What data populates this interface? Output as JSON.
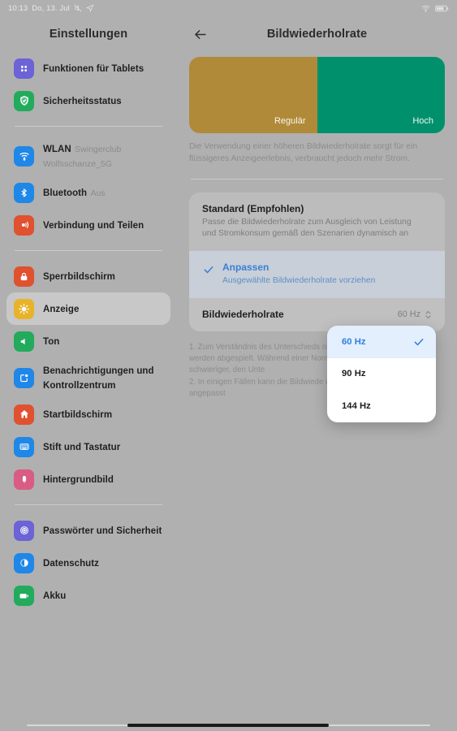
{
  "status_bar": {
    "time": "10:13",
    "date": "Do, 13. Jul",
    "left_icons": [
      "silent-mode-icon",
      "location-share-icon"
    ],
    "right_icons": [
      "wifi-icon",
      "battery-icon"
    ]
  },
  "sidebar": {
    "title": "Einstellungen",
    "groups": [
      {
        "items": [
          {
            "label": "Funktionen für Tablets",
            "sub": "",
            "icon": "tablet-features-icon",
            "color": "#6b63d6",
            "selected": false
          },
          {
            "label": "Sicherheitsstatus",
            "sub": "",
            "icon": "shield-check-icon",
            "color": "#22ab5d",
            "selected": false
          }
        ]
      },
      {
        "items": [
          {
            "label": "WLAN",
            "sub": "Swingerclub Wolfsschanze_5G",
            "icon": "wifi-icon",
            "color": "#1f87e8",
            "selected": false
          },
          {
            "label": "Bluetooth",
            "sub": "Aus",
            "icon": "bluetooth-icon",
            "color": "#1f87e8",
            "selected": false
          },
          {
            "label": "Verbindung und Teilen",
            "sub": "",
            "icon": "connection-share-icon",
            "color": "#e0512f",
            "selected": false
          }
        ]
      },
      {
        "items": [
          {
            "label": "Sperrbildschirm",
            "sub": "",
            "icon": "lock-icon",
            "color": "#e0512f",
            "selected": false
          },
          {
            "label": "Anzeige",
            "sub": "",
            "icon": "brightness-icon",
            "color": "#e8b32a",
            "selected": true
          },
          {
            "label": "Ton",
            "sub": "",
            "icon": "speaker-icon",
            "color": "#22ab5d",
            "selected": false
          },
          {
            "label": "Benachrichtigungen und Kontrollzentrum",
            "sub": "",
            "icon": "notification-icon",
            "color": "#1f87e8",
            "selected": false
          },
          {
            "label": "Startbildschirm",
            "sub": "",
            "icon": "home-icon",
            "color": "#e0512f",
            "selected": false
          },
          {
            "label": "Stift und Tastatur",
            "sub": "",
            "icon": "keyboard-icon",
            "color": "#1f87e8",
            "selected": false
          },
          {
            "label": "Hintergrundbild",
            "sub": "",
            "icon": "wallpaper-flower-icon",
            "color": "#d95c84",
            "selected": false
          }
        ]
      },
      {
        "items": [
          {
            "label": "Passwörter und Sicherheit",
            "sub": "",
            "icon": "fingerprint-icon",
            "color": "#6b63d6",
            "selected": false
          },
          {
            "label": "Datenschutz",
            "sub": "",
            "icon": "privacy-icon",
            "color": "#1f87e8",
            "selected": false
          },
          {
            "label": "Akku",
            "sub": "",
            "icon": "battery-icon",
            "color": "#22ab5d",
            "selected": false
          }
        ]
      }
    ]
  },
  "main": {
    "back_icon": "back-arrow-icon",
    "title": "Bildwiederholrate",
    "preview": {
      "left_label": "Regulär",
      "right_label": "Hoch",
      "left_color": "#b08a39",
      "right_color": "#00916c"
    },
    "preview_description": "Die Verwendung einer höheren Bildwiederholrate sorgt für ein flüssigeres Anzeigeerlebnis, verbraucht jedoch mehr Strom.",
    "options": [
      {
        "title": "Standard (Empfohlen)",
        "desc": "Passe die Bildwiederholrate zum Ausgleich von Leistung und Stromkonsum gemäß den Szenarien dynamisch an",
        "selected": false
      },
      {
        "title": "Anpassen",
        "desc": "Ausgewählte Bildwiederholrate vorziehen",
        "selected": true
      }
    ],
    "rate_row": {
      "label": "Bildwiederholrate",
      "value": "60 Hz",
      "stepper_icon": "chevron-up-down-icon"
    },
    "footnotes": [
      "1. Zum Verständnis des Unterschieds niedrigeren Bildwiederholrate werden abgespielt. Während einer Normalbe möglicherweise schwieriger, den Unte",
      "2. In einigen Fällen kann die Bildwiede der angezeigten Elemente angepasst"
    ]
  },
  "dropdown": {
    "options": [
      {
        "label": "60 Hz",
        "selected": true
      },
      {
        "label": "90 Hz",
        "selected": false
      },
      {
        "label": "144 Hz",
        "selected": false
      }
    ],
    "check_icon": "checkmark-icon"
  },
  "colors": {
    "accent_blue": "#3a7fd5",
    "dropdown_blue": "#2f7fe0",
    "scrim": "#b0b0b0"
  }
}
